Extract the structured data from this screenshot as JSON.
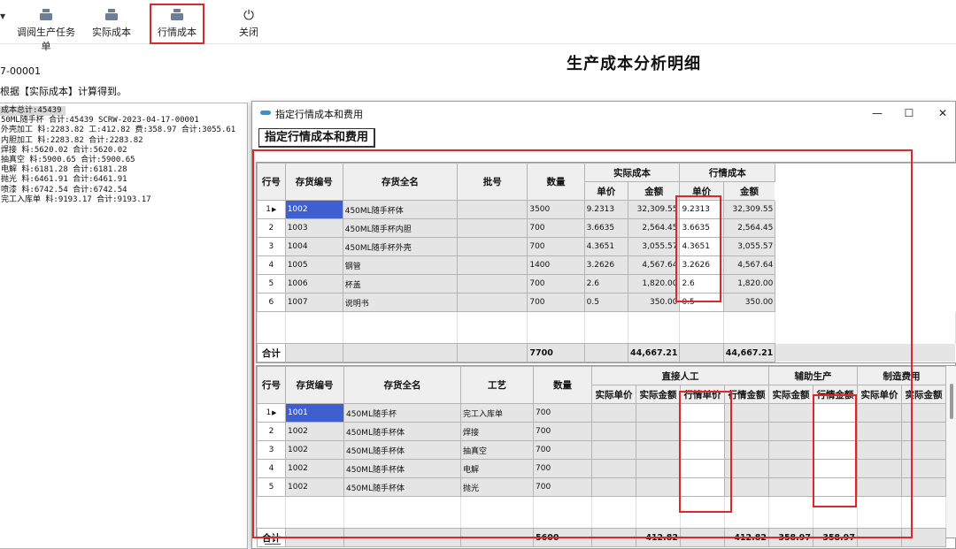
{
  "toolbar": {
    "buttons": [
      {
        "label": "调阅生产任务单",
        "icon": "printer-icon"
      },
      {
        "label": "实际成本",
        "icon": "printer-icon"
      },
      {
        "label": "行情成本",
        "icon": "printer-icon"
      },
      {
        "label": "关闭",
        "icon": "power-icon"
      }
    ]
  },
  "page": {
    "doc_no": "7-00001",
    "note": "根据【实际成本】计算得到。",
    "title": "生产成本分析明细"
  },
  "tree": {
    "lines": [
      "成本总计:45439",
      "50ML随手杯 合计:45439 SCRW-2023-04-17-00001",
      "外壳加工 料:2283.82 工:412.82 费:358.97 合计:3055.61",
      "内胆加工 料:2283.82 合计:2283.82",
      "焊接 料:5620.02 合计:5620.02",
      "抽真空 料:5900.65 合计:5900.65",
      "电解 料:6181.28 合计:6181.28",
      "抛光 料:6461.91 合计:6461.91",
      "喷漆 料:6742.54 合计:6742.54",
      "完工入库单 料:9193.17 合计:9193.17"
    ]
  },
  "dialog": {
    "title": "指定行情成本和费用",
    "caption": "指定行情成本和费用",
    "win_buttons": {
      "minimize": "—",
      "maximize": "☐",
      "close": "✕"
    }
  },
  "grid1": {
    "headers": {
      "row_no": "行号",
      "code": "存货编号",
      "name": "存货全名",
      "batch": "批号",
      "qty": "数量",
      "actual_cost": "实际成本",
      "market_cost": "行情成本",
      "unit_price": "单价",
      "amount": "金额"
    },
    "rows": [
      {
        "no": "1",
        "code": "1002",
        "name": "450ML随手杯体",
        "batch": "",
        "qty": "3500",
        "actual_price": "9.2313",
        "actual_amount": "32,309.55",
        "market_price": "9.2313",
        "market_amount": "32,309.55"
      },
      {
        "no": "2",
        "code": "1003",
        "name": "450ML随手杯内胆",
        "batch": "",
        "qty": "700",
        "actual_price": "3.6635",
        "actual_amount": "2,564.45",
        "market_price": "3.6635",
        "market_amount": "2,564.45"
      },
      {
        "no": "3",
        "code": "1004",
        "name": "450ML随手杯外壳",
        "batch": "",
        "qty": "700",
        "actual_price": "4.3651",
        "actual_amount": "3,055.57",
        "market_price": "4.3651",
        "market_amount": "3,055.57"
      },
      {
        "no": "4",
        "code": "1005",
        "name": "钢管",
        "batch": "",
        "qty": "1400",
        "actual_price": "3.2626",
        "actual_amount": "4,567.64",
        "market_price": "3.2626",
        "market_amount": "4,567.64"
      },
      {
        "no": "5",
        "code": "1006",
        "name": "杯盖",
        "batch": "",
        "qty": "700",
        "actual_price": "2.6",
        "actual_amount": "1,820.00",
        "market_price": "2.6",
        "market_amount": "1,820.00"
      },
      {
        "no": "6",
        "code": "1007",
        "name": "说明书",
        "batch": "",
        "qty": "700",
        "actual_price": "0.5",
        "actual_amount": "350.00",
        "market_price": "0.5",
        "market_amount": "350.00"
      }
    ],
    "total": {
      "label": "合计",
      "qty": "7700",
      "actual_amount": "44,667.21",
      "market_amount": "44,667.21"
    }
  },
  "grid2": {
    "headers": {
      "row_no": "行号",
      "code": "存货编号",
      "name": "存货全名",
      "process": "工艺",
      "qty": "数量",
      "direct_labor": "直接人工",
      "aux_production": "辅助生产",
      "mfg_expense": "制造费用",
      "actual_unit": "实际单价",
      "actual_amount": "实际金额",
      "market_unit": "行情单价",
      "market_amount": "行情金额"
    },
    "rows": [
      {
        "no": "1",
        "code": "1001",
        "name": "450ML随手杯",
        "process": "完工入库单",
        "qty": "700"
      },
      {
        "no": "2",
        "code": "1002",
        "name": "450ML随手杯体",
        "process": "焊接",
        "qty": "700"
      },
      {
        "no": "3",
        "code": "1002",
        "name": "450ML随手杯体",
        "process": "抽真空",
        "qty": "700"
      },
      {
        "no": "4",
        "code": "1002",
        "name": "450ML随手杯体",
        "process": "电解",
        "qty": "700"
      },
      {
        "no": "5",
        "code": "1002",
        "name": "450ML随手杯体",
        "process": "抛光",
        "qty": "700"
      }
    ],
    "total": {
      "label": "合计",
      "qty": "5600",
      "dl_actual_amount": "412.82",
      "dl_market_amount": "412.82",
      "ap_actual_amount": "358.97",
      "ap_market_amount": "358.97"
    }
  },
  "colors": {
    "highlight_box": "#e0262b",
    "selected_cell": "#3f5fd1"
  }
}
